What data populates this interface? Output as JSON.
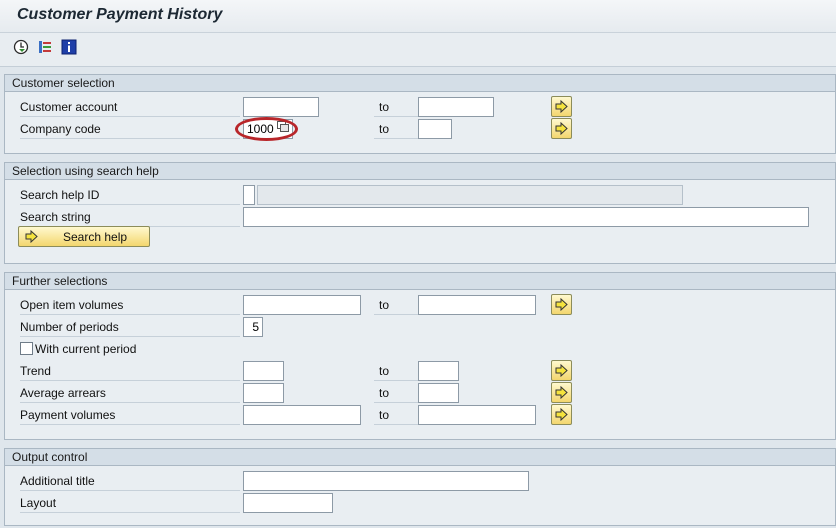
{
  "title": "Customer Payment History",
  "toolbar": {
    "icons": [
      "execute-icon",
      "selection-options-icon",
      "information-icon"
    ]
  },
  "customer_selection": {
    "heading": "Customer selection",
    "customer_account": {
      "label": "Customer account",
      "from": "",
      "to": ""
    },
    "company_code": {
      "label": "Company code",
      "from": "1000",
      "to": ""
    },
    "to_label": "to"
  },
  "search_help_section": {
    "heading": "Selection using search help",
    "search_help_id": {
      "label": "Search help ID",
      "value": "",
      "description": ""
    },
    "search_string": {
      "label": "Search string",
      "value": ""
    },
    "button_label": "Search help"
  },
  "further_selections": {
    "heading": "Further selections",
    "to_label": "to",
    "open_item_volumes": {
      "label": "Open item volumes",
      "from": "",
      "to": ""
    },
    "number_of_periods": {
      "label": "Number of periods",
      "value": "5"
    },
    "with_current_period": {
      "label": "With current period",
      "checked": false
    },
    "trend": {
      "label": "Trend",
      "from": "",
      "to": ""
    },
    "average_arrears": {
      "label": "Average arrears",
      "from": "",
      "to": ""
    },
    "payment_volumes": {
      "label": "Payment volumes",
      "from": "",
      "to": ""
    }
  },
  "output_control": {
    "heading": "Output control",
    "additional_title": {
      "label": "Additional title",
      "value": ""
    },
    "layout": {
      "label": "Layout",
      "value": ""
    }
  },
  "colors": {
    "highlight": "#b8262a",
    "button_yellow": "#f3d66e",
    "group_header": "#d4dee7"
  }
}
